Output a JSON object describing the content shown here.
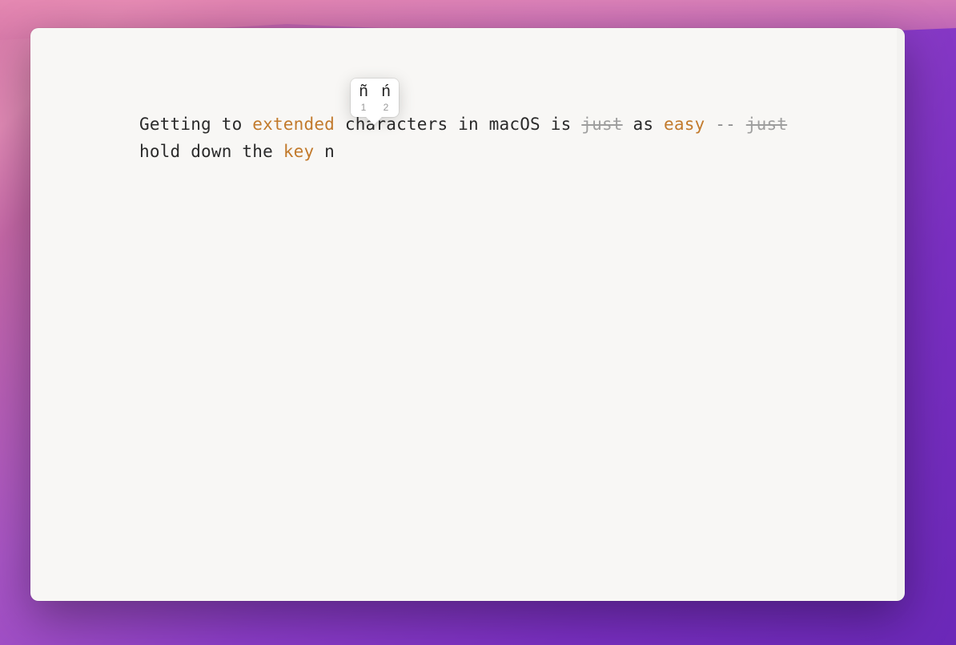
{
  "editor": {
    "segments": [
      {
        "text": "Getting to ",
        "class": ""
      },
      {
        "text": "extended",
        "class": "highlight"
      },
      {
        "text": " characters in macOS is ",
        "class": ""
      },
      {
        "text": "just",
        "class": "strike"
      },
      {
        "text": " as ",
        "class": ""
      },
      {
        "text": "easy",
        "class": "highlight"
      },
      {
        "text": " ",
        "class": ""
      },
      {
        "text": "--",
        "class": "dim"
      },
      {
        "text": " ",
        "class": ""
      },
      {
        "text": "just",
        "class": "strike"
      },
      {
        "text": " hold down the ",
        "class": ""
      },
      {
        "text": "key",
        "class": "highlight"
      },
      {
        "text": " n",
        "class": ""
      }
    ]
  },
  "accent_popup": {
    "options": [
      {
        "char": "ñ",
        "num": "1"
      },
      {
        "char": "ń",
        "num": "2"
      }
    ]
  }
}
